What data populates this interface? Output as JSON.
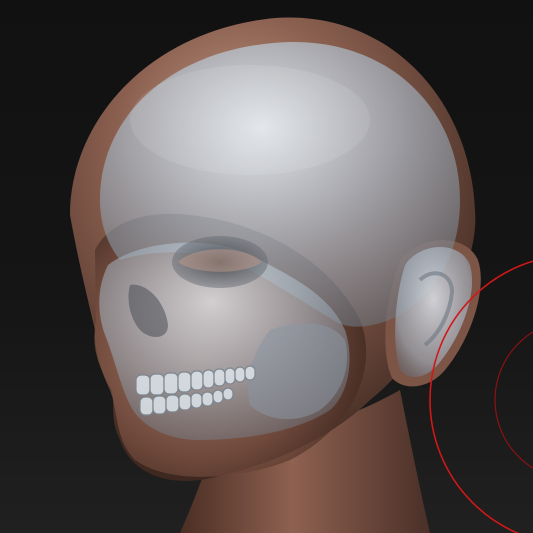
{
  "viewport": {
    "background_top": "#111111",
    "background_bottom": "#202020"
  },
  "model": {
    "skin_color": "#8a5f4f",
    "skin_highlight": "#c8a08c",
    "skin_shadow": "#3e2820",
    "skull_color": "#9aa8b4",
    "skull_highlight": "#dfe7ef"
  },
  "brush_cursor": {
    "color": "#d01818"
  }
}
